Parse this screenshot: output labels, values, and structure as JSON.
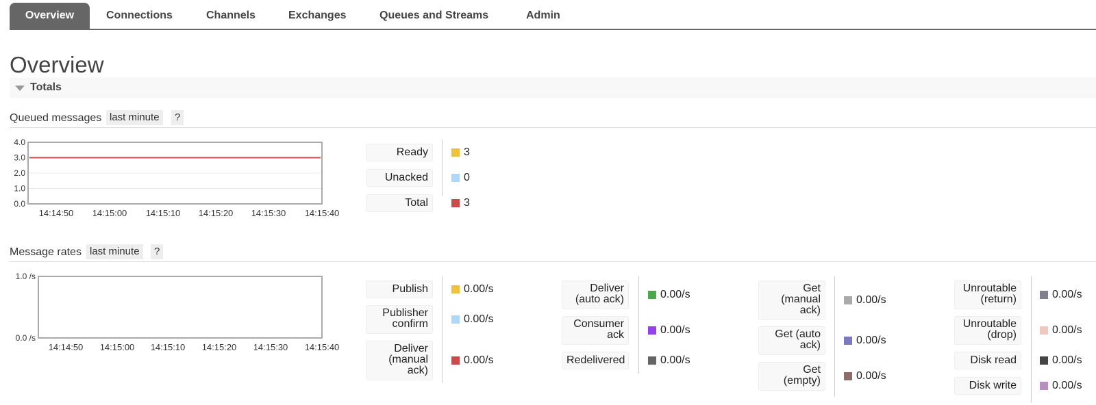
{
  "nav": {
    "tabs": [
      {
        "label": "Overview"
      },
      {
        "label": "Connections"
      },
      {
        "label": "Channels"
      },
      {
        "label": "Exchanges"
      },
      {
        "label": "Queues and Streams"
      },
      {
        "label": "Admin"
      }
    ]
  },
  "page_title": "Overview",
  "totals_label": "Totals",
  "queued": {
    "title": "Queued messages",
    "range": "last minute",
    "help": "?",
    "y_ticks": [
      "4.0",
      "3.0",
      "2.0",
      "1.0",
      "0.0"
    ],
    "x_ticks": [
      "14:14:50",
      "14:15:00",
      "14:15:10",
      "14:15:20",
      "14:15:30",
      "14:15:40"
    ],
    "legend": [
      {
        "label": "Ready",
        "value": "3",
        "color": "#edc240"
      },
      {
        "label": "Unacked",
        "value": "0",
        "color": "#afd8f8"
      },
      {
        "label": "Total",
        "value": "3",
        "color": "#cb4b4b"
      }
    ]
  },
  "rates": {
    "title": "Message rates",
    "range": "last minute",
    "help": "?",
    "y_ticks": [
      "1.0 /s",
      "0.0 /s"
    ],
    "x_ticks": [
      "14:14:50",
      "14:15:00",
      "14:15:10",
      "14:15:20",
      "14:15:30",
      "14:15:40"
    ],
    "col1": [
      {
        "label": "Publish",
        "value": "0.00/s",
        "color": "#edc240"
      },
      {
        "label": "Publisher confirm",
        "value": "0.00/s",
        "color": "#afd8f8"
      },
      {
        "label": "Deliver (manual ack)",
        "value": "0.00/s",
        "color": "#cb4b4b"
      }
    ],
    "col2": [
      {
        "label": "Deliver (auto ack)",
        "value": "0.00/s",
        "color": "#4da74d"
      },
      {
        "label": "Consumer ack",
        "value": "0.00/s",
        "color": "#9440ed"
      },
      {
        "label": "Redelivered",
        "value": "0.00/s",
        "color": "#666666"
      }
    ],
    "col3": [
      {
        "label": "Get (manual ack)",
        "value": "0.00/s",
        "color": "#aaaaaa"
      },
      {
        "label": "Get (auto ack)",
        "value": "0.00/s",
        "color": "#7c79c3"
      },
      {
        "label": "Get (empty)",
        "value": "0.00/s",
        "color": "#8d6c6c"
      }
    ],
    "col4": [
      {
        "label": "Unroutable (return)",
        "value": "0.00/s",
        "color": "#7f7f8f"
      },
      {
        "label": "Unroutable (drop)",
        "value": "0.00/s",
        "color": "#f0c8c0"
      },
      {
        "label": "Disk read",
        "value": "0.00/s",
        "color": "#444444"
      },
      {
        "label": "Disk write",
        "value": "0.00/s",
        "color": "#b98ec0"
      }
    ]
  },
  "chart_data": [
    {
      "type": "line",
      "x": [
        "14:14:50",
        "14:15:00",
        "14:15:10",
        "14:15:20",
        "14:15:30",
        "14:15:40"
      ],
      "series": [
        {
          "name": "Ready",
          "values": [
            3,
            3,
            3,
            3,
            3,
            3
          ]
        },
        {
          "name": "Unacked",
          "values": [
            0,
            0,
            0,
            0,
            0,
            0
          ]
        },
        {
          "name": "Total",
          "values": [
            3,
            3,
            3,
            3,
            3,
            3
          ]
        }
      ],
      "ylim": [
        0,
        4
      ],
      "grid": true
    },
    {
      "type": "line",
      "x": [
        "14:14:50",
        "14:15:00",
        "14:15:10",
        "14:15:20",
        "14:15:30",
        "14:15:40"
      ],
      "series": [
        {
          "name": "Publish",
          "values": [
            0,
            0,
            0,
            0,
            0,
            0
          ]
        },
        {
          "name": "Publisher confirm",
          "values": [
            0,
            0,
            0,
            0,
            0,
            0
          ]
        },
        {
          "name": "Deliver (manual ack)",
          "values": [
            0,
            0,
            0,
            0,
            0,
            0
          ]
        },
        {
          "name": "Deliver (auto ack)",
          "values": [
            0,
            0,
            0,
            0,
            0,
            0
          ]
        },
        {
          "name": "Consumer ack",
          "values": [
            0,
            0,
            0,
            0,
            0,
            0
          ]
        },
        {
          "name": "Redelivered",
          "values": [
            0,
            0,
            0,
            0,
            0,
            0
          ]
        },
        {
          "name": "Get (manual ack)",
          "values": [
            0,
            0,
            0,
            0,
            0,
            0
          ]
        },
        {
          "name": "Get (auto ack)",
          "values": [
            0,
            0,
            0,
            0,
            0,
            0
          ]
        },
        {
          "name": "Get (empty)",
          "values": [
            0,
            0,
            0,
            0,
            0,
            0
          ]
        },
        {
          "name": "Unroutable (return)",
          "values": [
            0,
            0,
            0,
            0,
            0,
            0
          ]
        },
        {
          "name": "Unroutable (drop)",
          "values": [
            0,
            0,
            0,
            0,
            0,
            0
          ]
        },
        {
          "name": "Disk read",
          "values": [
            0,
            0,
            0,
            0,
            0,
            0
          ]
        },
        {
          "name": "Disk write",
          "values": [
            0,
            0,
            0,
            0,
            0,
            0
          ]
        }
      ],
      "ylim": [
        0,
        1
      ],
      "grid": false
    }
  ]
}
